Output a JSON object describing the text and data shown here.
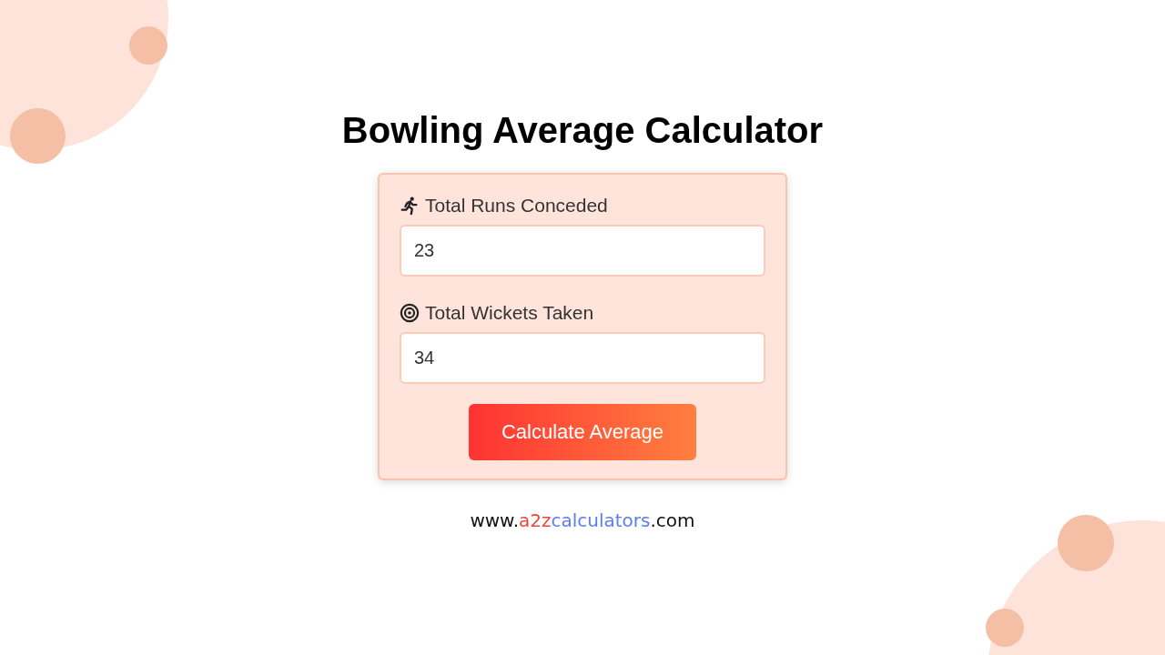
{
  "title": "Bowling Average Calculator",
  "fields": [
    {
      "kind": "runner",
      "label": "Total Runs Conceded",
      "value": "23"
    },
    {
      "kind": "target",
      "label": "Total Wickets Taken",
      "value": "34"
    }
  ],
  "button": "Calculate Average",
  "website": [
    {
      "text": "www.",
      "color": "#111111"
    },
    {
      "text": "a2z",
      "color": "#f04438"
    },
    {
      "text": "calculators",
      "color": "#5a7ef0"
    },
    {
      "text": ".com",
      "color": "#111111"
    }
  ]
}
